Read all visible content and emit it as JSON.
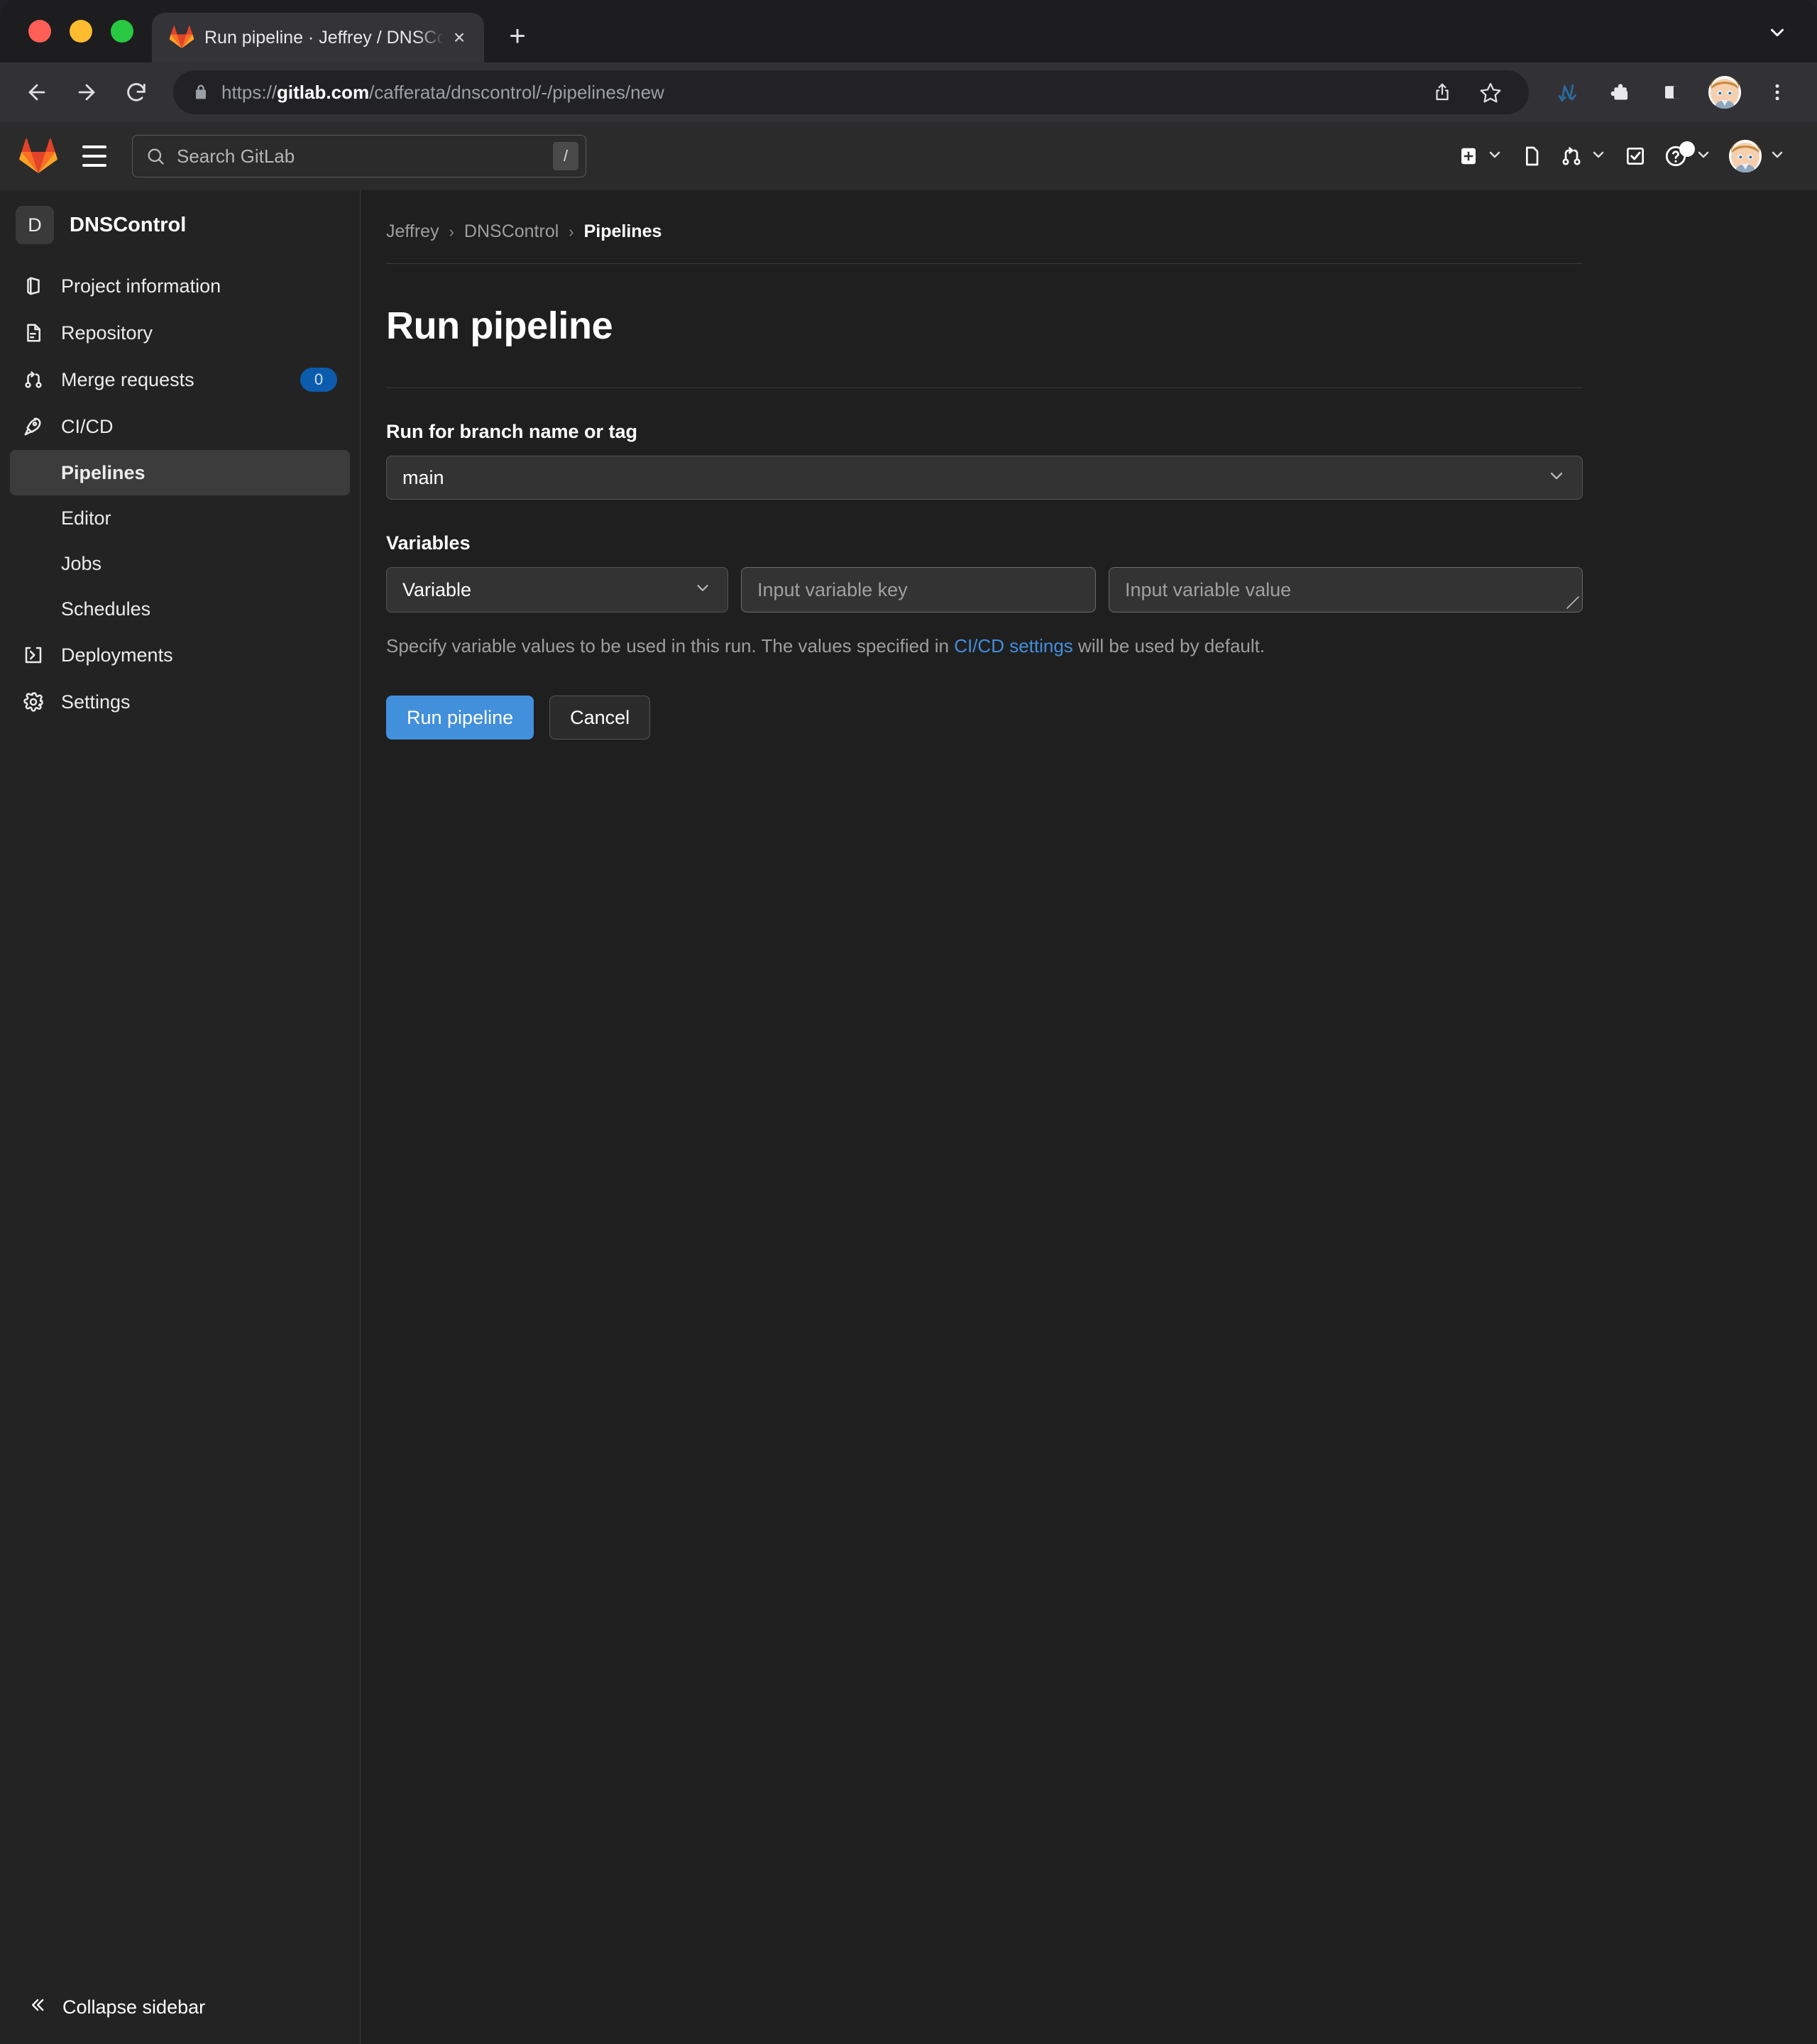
{
  "browser": {
    "window_controls": [
      "close",
      "minimize",
      "maximize"
    ],
    "tab": {
      "title": "Run pipeline · Jeffrey / DNSCon",
      "favicon": "gitlab-favicon",
      "close_label": "×"
    },
    "new_tab_label": "+",
    "nav": {
      "back": "←",
      "forward": "→",
      "reload": "⟳"
    },
    "omnibox": {
      "scheme": "https://",
      "host": "gitlab.com",
      "path": "/cafferata/dnscontrol/-/pipelines/new",
      "lock_icon": "lock-icon"
    },
    "toolbar_icons": [
      "share-icon",
      "bookmark-star-icon",
      "gitlab-extension-icon",
      "extensions-puzzle-icon",
      "side-panel-icon",
      "profile-avatar",
      "chrome-menu-icon"
    ]
  },
  "gitlab_header": {
    "logo": "gitlab-logo",
    "menu_icon": "hamburger-menu-icon",
    "search": {
      "placeholder": "Search GitLab",
      "shortcut": "/",
      "icon": "search-icon"
    },
    "actions": [
      {
        "name": "create-new",
        "icon": "plus-square-icon",
        "has_chevron": true
      },
      {
        "name": "issues",
        "icon": "issues-icon",
        "has_chevron": false
      },
      {
        "name": "merge-requests",
        "icon": "merge-request-icon",
        "has_chevron": true
      },
      {
        "name": "todos",
        "icon": "todo-checkbox-icon",
        "has_chevron": false
      },
      {
        "name": "help",
        "icon": "help-question-icon",
        "has_chevron": true,
        "has_notification_dot": true
      },
      {
        "name": "user-menu",
        "icon": "user-avatar",
        "has_chevron": true
      }
    ]
  },
  "sidebar": {
    "project": {
      "initial": "D",
      "name": "DNSControl"
    },
    "items": [
      {
        "label": "Project information",
        "icon": "project-info-icon",
        "active": false
      },
      {
        "label": "Repository",
        "icon": "document-icon",
        "active": false
      },
      {
        "label": "Merge requests",
        "icon": "merge-request-icon",
        "active": false,
        "badge": "0"
      },
      {
        "label": "CI/CD",
        "icon": "rocket-icon",
        "active": false
      }
    ],
    "cicd_children": [
      {
        "label": "Pipelines",
        "active": true
      },
      {
        "label": "Editor",
        "active": false
      },
      {
        "label": "Jobs",
        "active": false
      },
      {
        "label": "Schedules",
        "active": false
      }
    ],
    "items_after": [
      {
        "label": "Deployments",
        "icon": "deployments-icon",
        "active": false
      },
      {
        "label": "Settings",
        "icon": "gear-icon",
        "active": false
      }
    ],
    "collapse": {
      "label": "Collapse sidebar",
      "icon": "double-chevron-left-icon"
    }
  },
  "main": {
    "breadcrumb": [
      {
        "label": "Jeffrey",
        "current": false
      },
      {
        "label": "DNSControl",
        "current": false
      },
      {
        "label": "Pipelines",
        "current": true
      }
    ],
    "breadcrumb_separator": "›",
    "page_title": "Run pipeline",
    "branch_field": {
      "label": "Run for branch name or tag",
      "value": "main",
      "chevron_icon": "chevron-down-icon"
    },
    "variables": {
      "label": "Variables",
      "type_value": "Variable",
      "type_chevron_icon": "chevron-down-icon",
      "key_placeholder": "Input variable key",
      "key_value": "",
      "value_placeholder": "Input variable value",
      "value_value": "",
      "help_prefix": "Specify variable values to be used in this run. The values specified in ",
      "help_link": "CI/CD settings",
      "help_suffix": " will be used by default."
    },
    "buttons": {
      "primary": "Run pipeline",
      "secondary": "Cancel"
    }
  },
  "colors": {
    "accent_blue": "#428fdc",
    "badge_blue": "#0b5cad",
    "app_background": "#1f1f1f",
    "sidebar_background": "#232323",
    "header_background": "#2b2b2b",
    "input_background": "#333333"
  }
}
